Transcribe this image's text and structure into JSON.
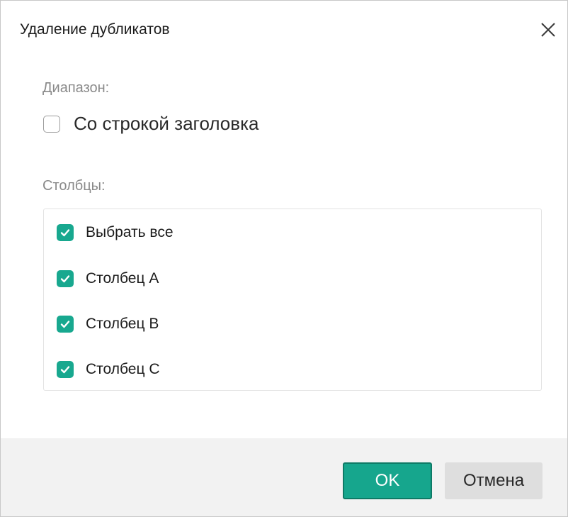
{
  "dialog": {
    "title": "Удаление дубликатов",
    "close_icon": "close-icon"
  },
  "range": {
    "label": "Диапазон:",
    "header_checkbox": {
      "label": "Со строкой заголовка",
      "checked": false
    }
  },
  "columns": {
    "label": "Столбцы:",
    "items": [
      {
        "label": "Выбрать все",
        "checked": true
      },
      {
        "label": "Столбец A",
        "checked": true
      },
      {
        "label": "Столбец B",
        "checked": true
      },
      {
        "label": "Столбец C",
        "checked": true
      }
    ]
  },
  "buttons": {
    "ok": "OK",
    "cancel": "Отмена"
  },
  "colors": {
    "accent": "#18a88f",
    "ok_border": "#0e7a66",
    "footer_bg": "#f2f2f2",
    "cancel_bg": "#dedede"
  }
}
